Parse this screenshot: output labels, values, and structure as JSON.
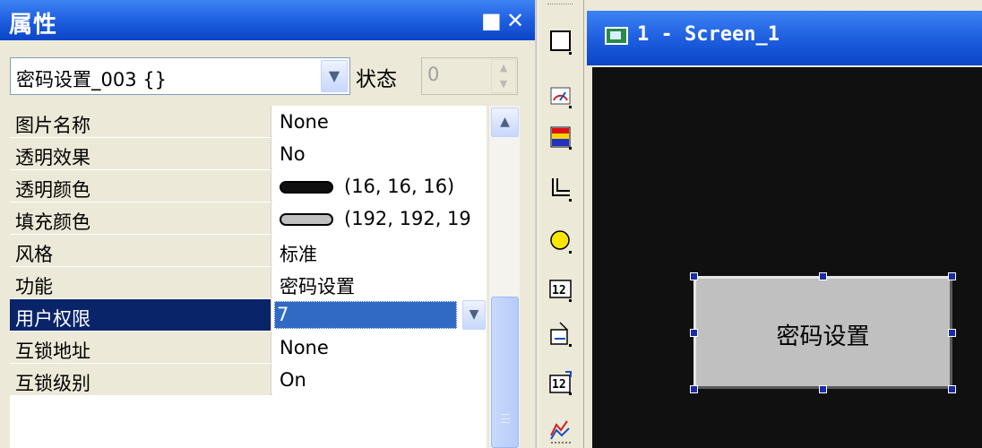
{
  "properties_panel": {
    "title": "属性",
    "maximize_glyph": "■",
    "close_glyph": "✕",
    "object_combo": {
      "value": "密码设置_003 {}",
      "arrow": "⌄"
    },
    "state_label": "状态",
    "state_value": "0",
    "rows": [
      {
        "name": "图片名称",
        "value": "None"
      },
      {
        "name": "透明效果",
        "value": "No"
      },
      {
        "name": "透明颜色",
        "value": "(16, 16, 16)",
        "swatch_color": "#101010"
      },
      {
        "name": "填充颜色",
        "value": "(192, 192, 19",
        "swatch_color": "#c0c0c0"
      },
      {
        "name": "风格",
        "value": "标准"
      },
      {
        "name": "功能",
        "value": "密码设置"
      },
      {
        "name": "用户权限",
        "value": "7",
        "selected": true
      },
      {
        "name": "互锁地址",
        "value": "None"
      },
      {
        "name": "互锁级别",
        "value": "On"
      }
    ]
  },
  "screen_editor": {
    "title": "1 - Screen_1",
    "button_label": "密码设置",
    "canvas_color": "#101010",
    "button_color": "#c0c0c0"
  },
  "toolbar": {
    "tools": [
      "rectangle-icon",
      "gauge-icon",
      "bar-graph-icon",
      "pipe-icon",
      "lamp-icon",
      "numeric-display-icon",
      "data-entry-icon",
      "numeric-input-icon",
      "trend-graph-icon"
    ]
  }
}
